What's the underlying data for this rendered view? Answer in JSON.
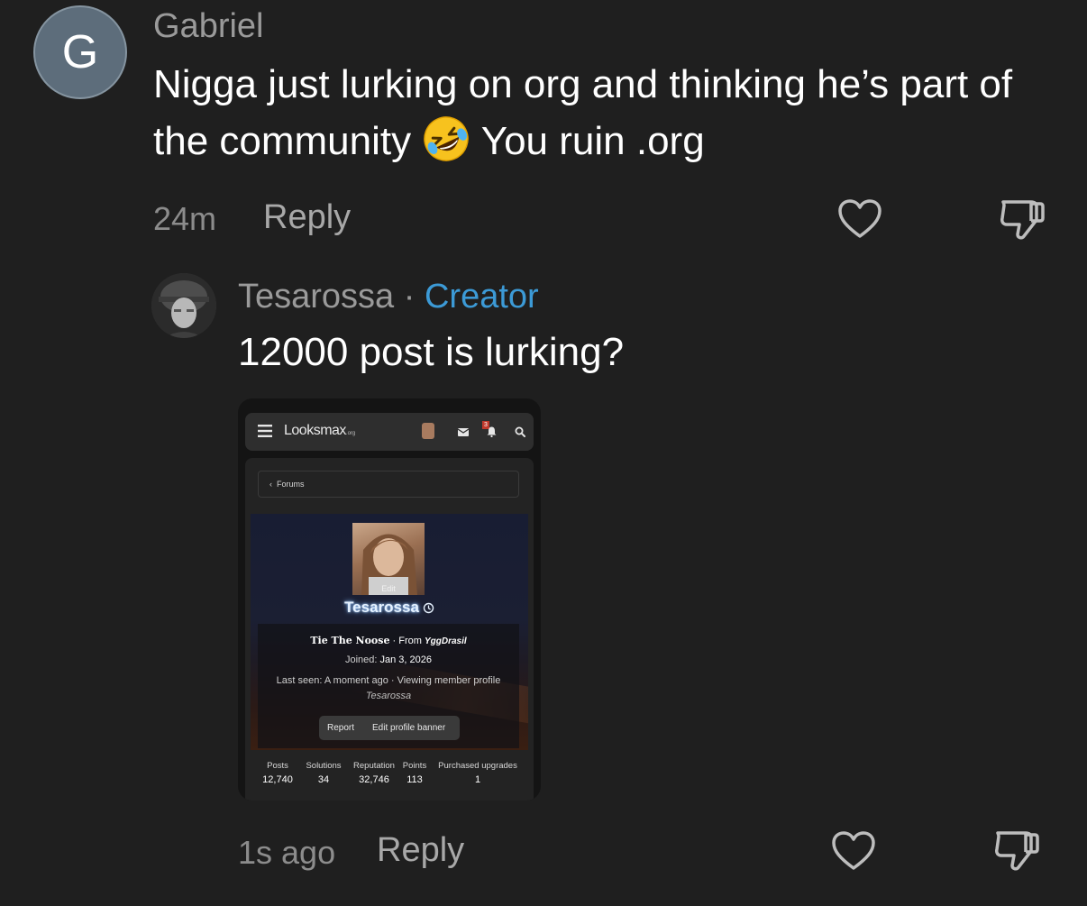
{
  "comment1": {
    "avatar_letter": "G",
    "author": "Gabriel",
    "text_part1": "Nigga just lurking on org and thinking he’s part of the community",
    "emoji": "rolling-on-floor-laughing",
    "text_part2": "You ruin .org",
    "time": "24m",
    "reply_label": "Reply"
  },
  "comment2": {
    "author": "Tesarossa",
    "separator": "·",
    "role": "Creator",
    "text": "12000 post is lurking?",
    "time": "1s ago",
    "reply_label": "Reply"
  },
  "screenshot": {
    "logo": "Looksmax",
    "logo_suffix": ".org",
    "alert_count": "3",
    "back_link": "Forums",
    "edit_label": "Edit",
    "username": "Tesarossa",
    "title_text": "Tie The Noose",
    "from_label": "· From",
    "location": "YggDrasil",
    "joined_label": "Joined:",
    "joined_date": "Jan 3, 2026",
    "last_seen_label": "Last seen:",
    "last_seen_value": "A moment ago · Viewing member profile",
    "last_seen_target": "Tesarossa",
    "report_label": "Report",
    "banner_label": "Edit profile banner",
    "stats": [
      {
        "label": "Posts",
        "value": "12,740"
      },
      {
        "label": "Solutions",
        "value": "34"
      },
      {
        "label": "Reputation",
        "value": "32,746"
      },
      {
        "label": "Points",
        "value": "113"
      },
      {
        "label": "Purchased upgrades",
        "value": "1"
      }
    ]
  }
}
